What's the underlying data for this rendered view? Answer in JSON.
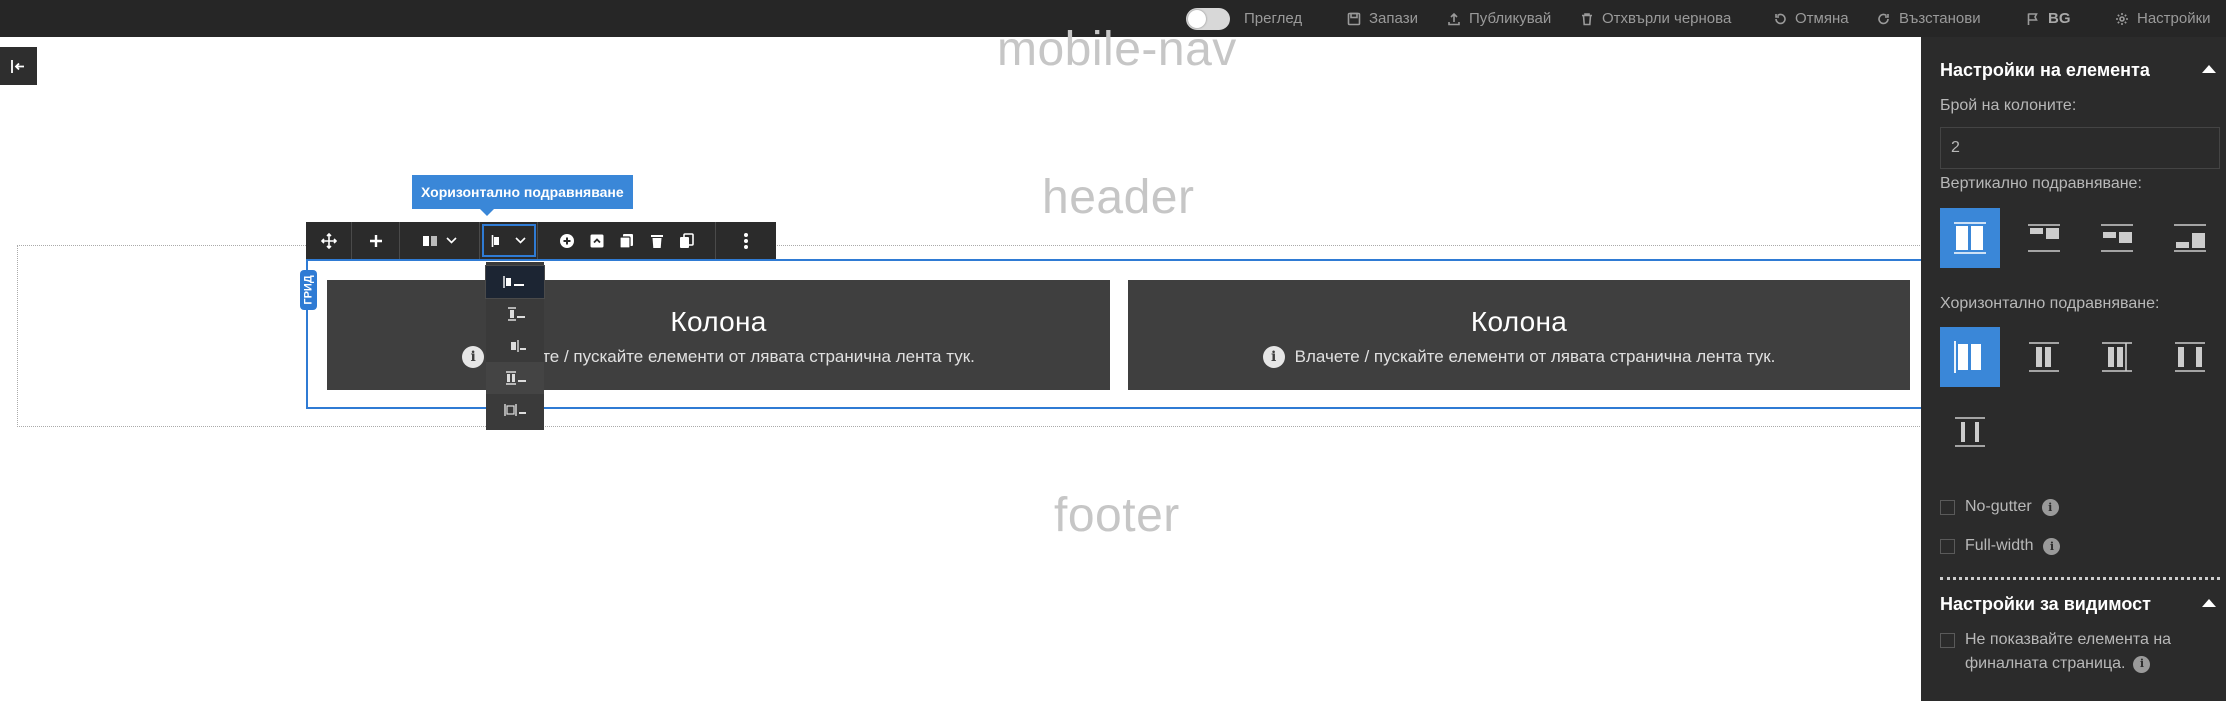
{
  "topbar": {
    "preview_label": "Преглед",
    "save_label": "Запази",
    "publish_label": "Публикувай",
    "discard_label": "Отхвърли чернова",
    "undo_label": "Отмяна",
    "redo_label": "Възстанови",
    "language_label": "BG",
    "settings_label": "Настройки"
  },
  "canvas": {
    "mobile_nav": "mobile-nav",
    "header": "header",
    "footer": "footer",
    "grid_tag": "ГРИД",
    "columns": [
      {
        "title": "Колона",
        "hint": "Влачете / пускайте елементи от лявата странична лента тук."
      },
      {
        "title": "Колона",
        "hint": "Влачете / пускайте елементи от лявата странична лента тук."
      }
    ]
  },
  "toolbar": {
    "tooltip": "Хоризонтално подравняване",
    "dropdown_options": [
      "align-left",
      "align-center",
      "align-right",
      "align-between",
      "align-around"
    ],
    "selected_option": "align-left"
  },
  "panel": {
    "element_settings_title": "Настройки на елемента",
    "columns_count_label": "Брой на колоните:",
    "columns_count_value": "2",
    "vertical_align_label": "Вертикално подравняване:",
    "horizontal_align_label": "Хоризонтално подравняване:",
    "no_gutter_label": "No-gutter",
    "full_width_label": "Full-width",
    "visibility_title": "Настройки за видимост",
    "hide_label_line1": "Не показвайте елемента на",
    "hide_label_line2": "финалната страница."
  },
  "colors": {
    "accent": "#2f7bd4",
    "topbar_bg": "#262626",
    "panel_bg": "#2b2b2b",
    "column_bg": "#3f3f3f"
  }
}
